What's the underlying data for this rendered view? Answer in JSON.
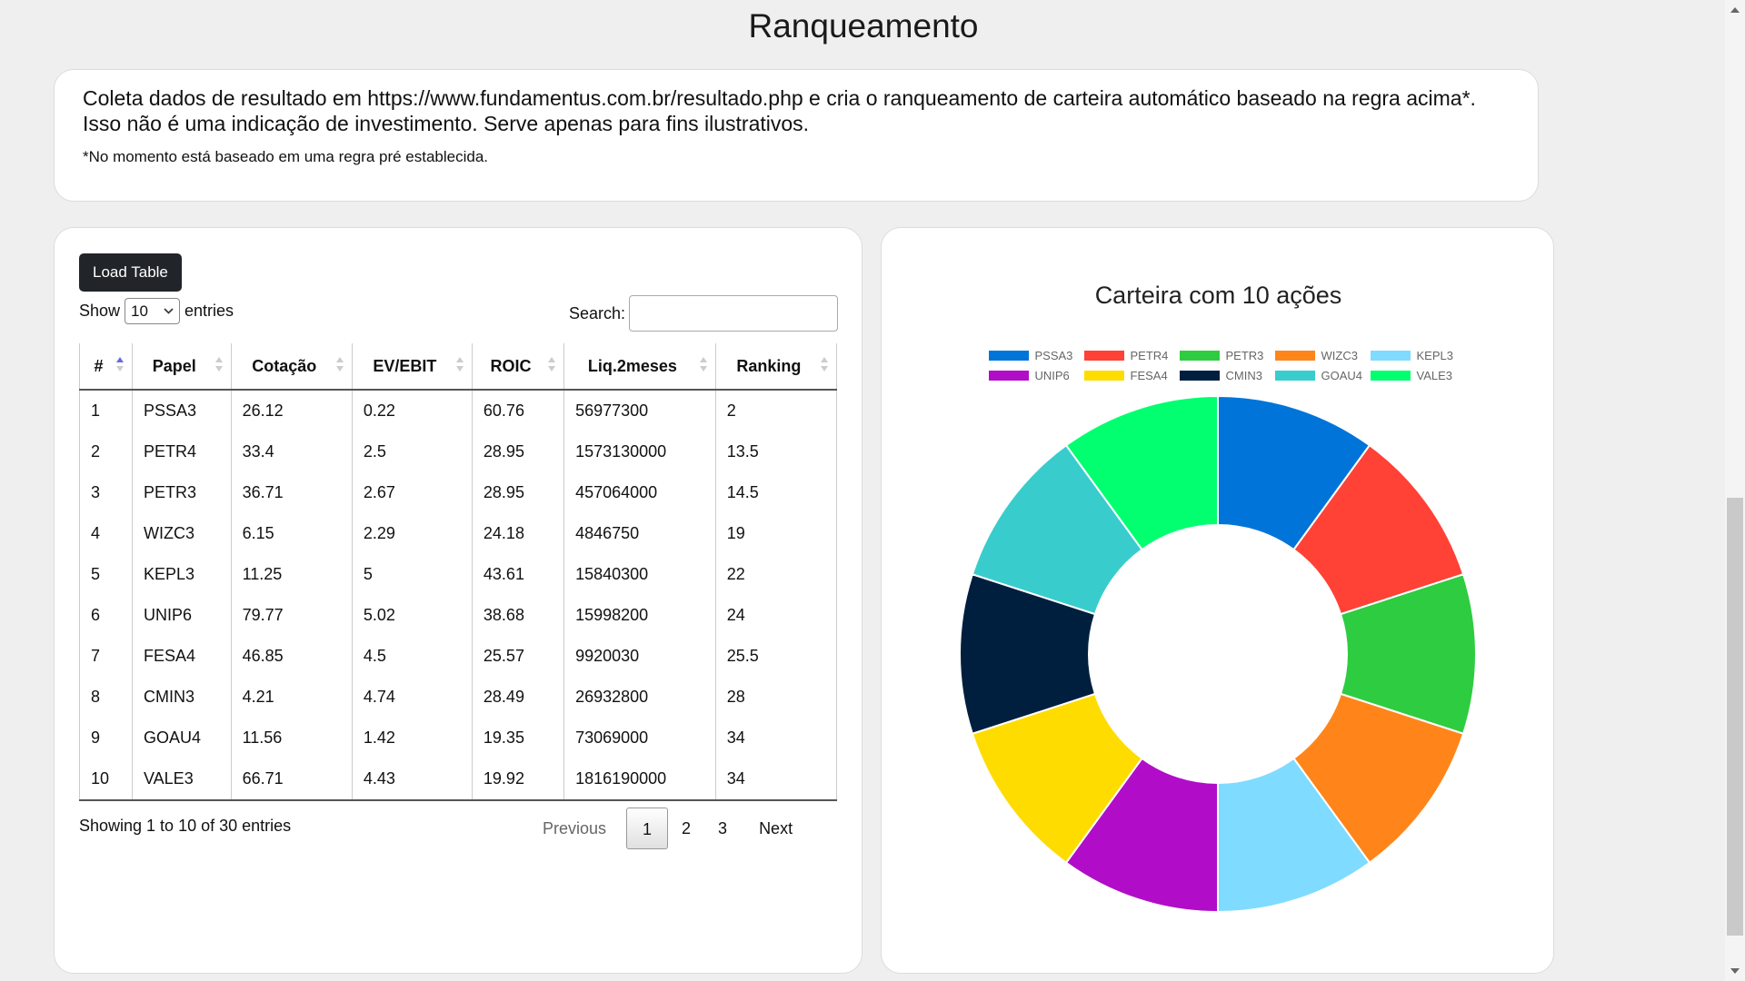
{
  "page": {
    "title": "Ranqueamento",
    "description": "Coleta dados de resultado em https://www.fundamentus.com.br/resultado.php e cria o ranqueamento de carteira automático baseado na regra acima*. Isso não é uma indicação de investimento. Serve apenas para fins ilustrativos.",
    "note": "*No momento está baseado em uma regra pré establecida."
  },
  "table_panel": {
    "load_button": "Load Table",
    "show_label": "Show",
    "entries_value": "10",
    "entries_label": "entries",
    "search_label": "Search:",
    "search_value": "",
    "columns": [
      "#",
      "Papel",
      "Cotação",
      "EV/EBIT",
      "ROIC",
      "Liq.2meses",
      "Ranking"
    ],
    "rows": [
      [
        "1",
        "PSSA3",
        "26.12",
        "0.22",
        "60.76",
        "56977300",
        "2"
      ],
      [
        "2",
        "PETR4",
        "33.4",
        "2.5",
        "28.95",
        "1573130000",
        "13.5"
      ],
      [
        "3",
        "PETR3",
        "36.71",
        "2.67",
        "28.95",
        "457064000",
        "14.5"
      ],
      [
        "4",
        "WIZC3",
        "6.15",
        "2.29",
        "24.18",
        "4846750",
        "19"
      ],
      [
        "5",
        "KEPL3",
        "11.25",
        "5",
        "43.61",
        "15840300",
        "22"
      ],
      [
        "6",
        "UNIP6",
        "79.77",
        "5.02",
        "38.68",
        "15998200",
        "24"
      ],
      [
        "7",
        "FESA4",
        "46.85",
        "4.5",
        "25.57",
        "9920030",
        "25.5"
      ],
      [
        "8",
        "CMIN3",
        "4.21",
        "4.74",
        "28.49",
        "26932800",
        "28"
      ],
      [
        "9",
        "GOAU4",
        "11.56",
        "1.42",
        "19.35",
        "73069000",
        "34"
      ],
      [
        "10",
        "VALE3",
        "66.71",
        "4.43",
        "19.92",
        "1816190000",
        "34"
      ]
    ],
    "info": "Showing 1 to 10 of 30 entries",
    "pagination": {
      "previous": "Previous",
      "pages": [
        "1",
        "2",
        "3"
      ],
      "current": "1",
      "next": "Next"
    }
  },
  "chart_data": {
    "type": "pie",
    "title": "Carteira com 10 ações",
    "labels": [
      "PSSA3",
      "PETR4",
      "PETR3",
      "WIZC3",
      "KEPL3",
      "UNIP6",
      "FESA4",
      "CMIN3",
      "GOAU4",
      "VALE3"
    ],
    "values": [
      1,
      1,
      1,
      1,
      1,
      1,
      1,
      1,
      1,
      1
    ],
    "colors": [
      "#0074d9",
      "#ff4136",
      "#2ecc40",
      "#ff851b",
      "#7fdbff",
      "#b10dc9",
      "#ffdc00",
      "#001f3f",
      "#39cccc",
      "#01ff70"
    ],
    "legend_position": "top",
    "donut": true
  }
}
